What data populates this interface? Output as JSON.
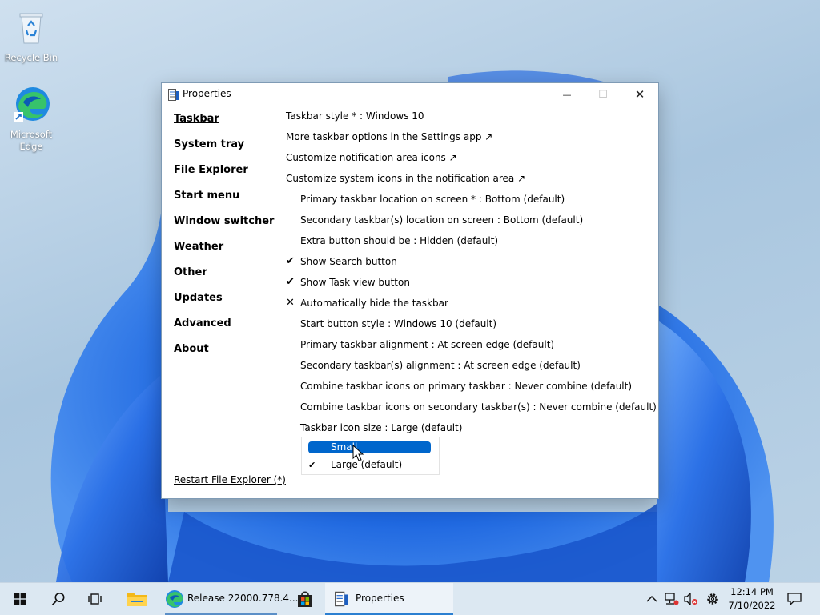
{
  "desktop": {
    "icons": [
      {
        "label": "Recycle Bin"
      },
      {
        "label": "Microsoft Edge"
      }
    ]
  },
  "window": {
    "title": "Properties",
    "controls": {
      "minimize": "—",
      "maximize": "☐",
      "close": "✕"
    },
    "nav": [
      {
        "label": "Taskbar",
        "active": true
      },
      {
        "label": "System tray"
      },
      {
        "label": "File Explorer"
      },
      {
        "label": "Start menu"
      },
      {
        "label": "Window switcher"
      },
      {
        "label": "Weather"
      },
      {
        "label": "Other"
      },
      {
        "label": "Updates"
      },
      {
        "label": "Advanced"
      },
      {
        "label": "About"
      }
    ],
    "restart_label": "Restart File Explorer (*)",
    "options": [
      {
        "text": "Taskbar style * : Windows 10",
        "indent": false,
        "mark": ""
      },
      {
        "text": "More taskbar options in the Settings app ↗",
        "indent": false,
        "mark": ""
      },
      {
        "text": "Customize notification area icons ↗",
        "indent": false,
        "mark": ""
      },
      {
        "text": "Customize system icons in the notification area ↗",
        "indent": false,
        "mark": ""
      },
      {
        "text": "Primary taskbar location on screen * : Bottom (default)",
        "indent": true,
        "mark": ""
      },
      {
        "text": "Secondary taskbar(s) location on screen : Bottom (default)",
        "indent": true,
        "mark": ""
      },
      {
        "text": "Extra button should be : Hidden (default)",
        "indent": true,
        "mark": ""
      },
      {
        "text": "Show Search button",
        "indent": true,
        "mark": "✔"
      },
      {
        "text": "Show Task view button",
        "indent": true,
        "mark": "✔"
      },
      {
        "text": "Automatically hide the taskbar",
        "indent": true,
        "mark": "✕"
      },
      {
        "text": "Start button style : Windows 10 (default)",
        "indent": true,
        "mark": ""
      },
      {
        "text": "Primary taskbar alignment : At screen edge (default)",
        "indent": true,
        "mark": ""
      },
      {
        "text": "Secondary taskbar(s) alignment : At screen edge (default)",
        "indent": true,
        "mark": ""
      },
      {
        "text": "Combine taskbar icons on primary taskbar : Never combine (default)",
        "indent": true,
        "mark": ""
      },
      {
        "text": "Combine taskbar icons on secondary taskbar(s) : Never combine (default)",
        "indent": true,
        "mark": ""
      },
      {
        "text": "Taskbar icon size : Large (default)",
        "indent": true,
        "mark": ""
      }
    ],
    "dropdown": {
      "items": [
        {
          "label": "Small",
          "highlighted": true,
          "checked": false
        },
        {
          "label": "Large (default)",
          "highlighted": false,
          "checked": true
        }
      ],
      "check_glyph": "✔"
    }
  },
  "taskbar": {
    "apps": [
      {
        "label": "Release 22000.778.4..."
      },
      {
        "label": "Properties"
      }
    ],
    "clock": {
      "time": "12:14 PM",
      "date": "7/10/2022"
    },
    "colors": {
      "accent": "#0066cc",
      "taskbar_bg": "#dce8f2"
    }
  }
}
